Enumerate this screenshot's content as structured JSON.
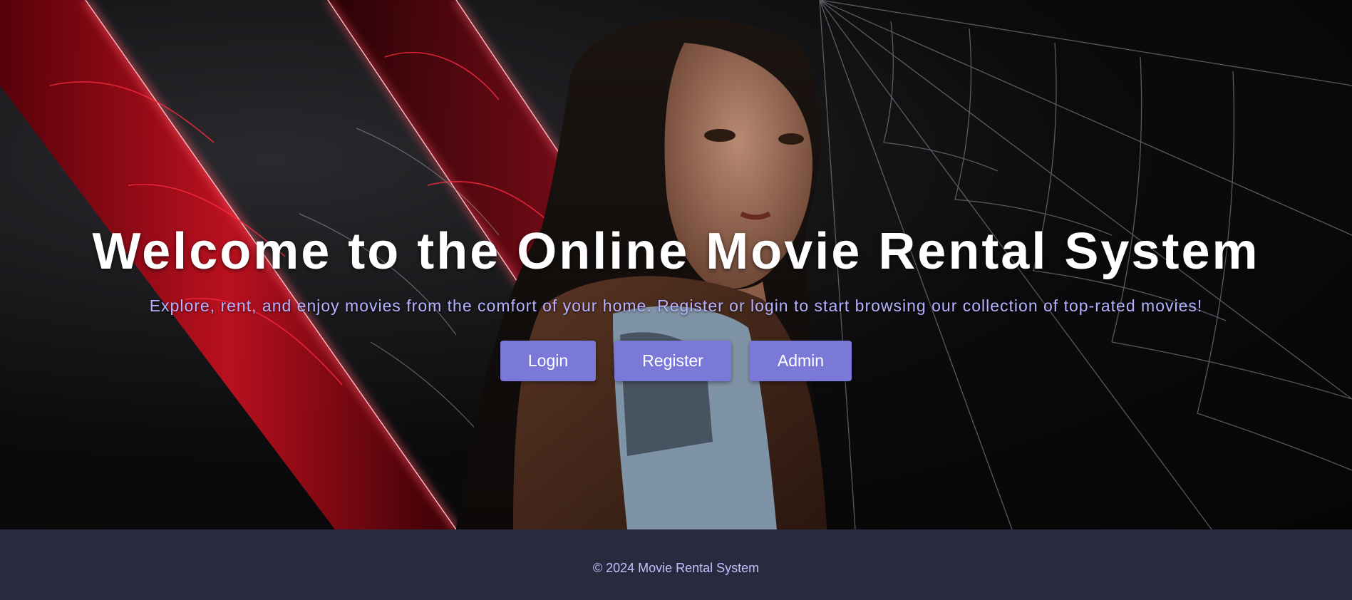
{
  "hero": {
    "title": "Welcome to the Online Movie Rental System",
    "subtitle": "Explore, rent, and enjoy movies from the comfort of your home. Register or login to start browsing our collection of top-rated movies!"
  },
  "actions": {
    "login_label": "Login",
    "register_label": "Register",
    "admin_label": "Admin"
  },
  "footer": {
    "copyright": "© 2024 Movie Rental System"
  },
  "colors": {
    "button_bg": "#7b79d8",
    "subtitle": "#b6b2ff",
    "footer_bg": "#282b3e",
    "footer_text": "#c3c0ff",
    "accent_red": "#e0182c"
  }
}
